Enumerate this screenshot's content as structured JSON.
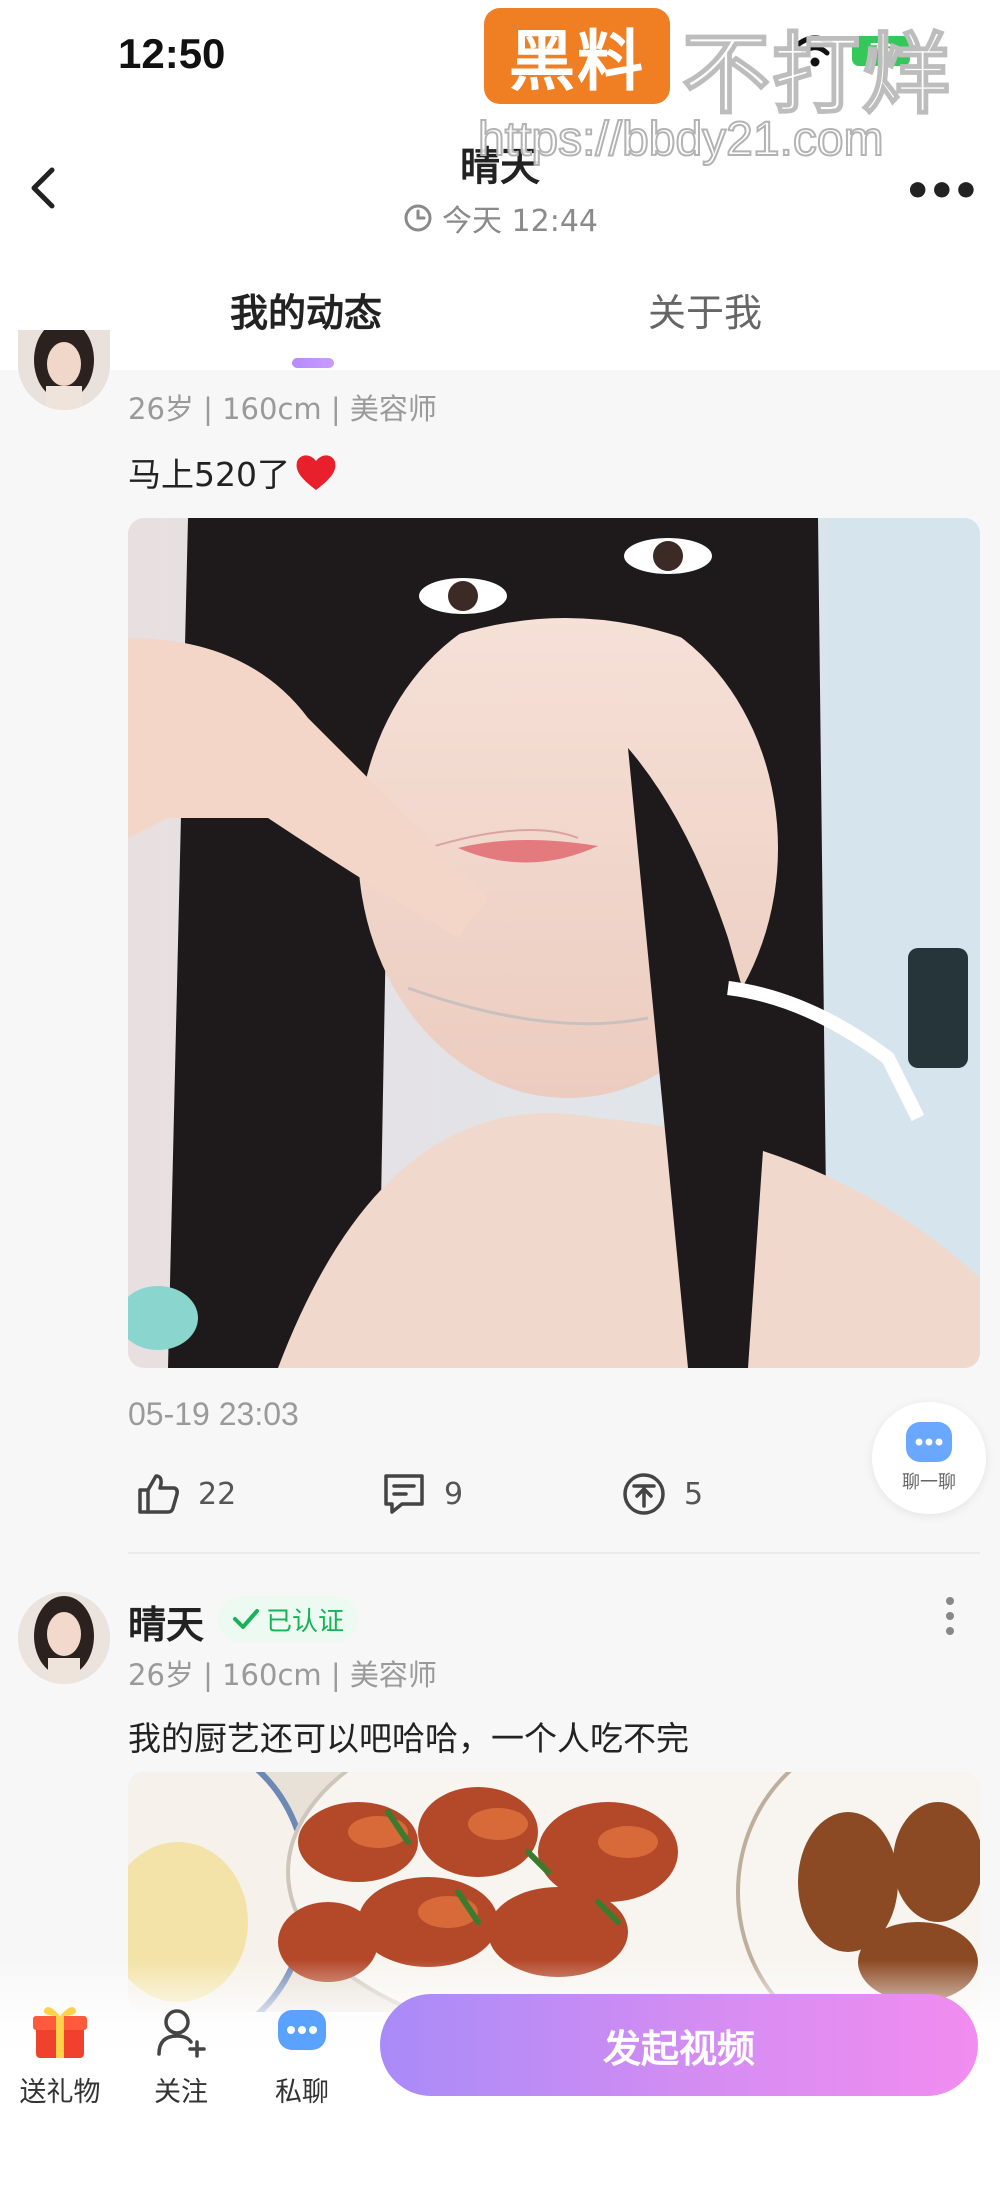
{
  "status_bar": {
    "time": "12:50",
    "battery": "76"
  },
  "watermark": {
    "badge": "黑料",
    "text": "不打烊",
    "url": "https://bbdy21.com"
  },
  "header": {
    "title": "晴天",
    "subtitle": "今天 12:44",
    "tabs": [
      {
        "label": "我的动态",
        "active": true
      },
      {
        "label": "关于我",
        "active": false
      }
    ]
  },
  "posts": [
    {
      "meta": "26岁 | 160cm | 美容师",
      "text": "马上520了",
      "date": "05-19 23:03",
      "likes": "22",
      "comments": "9",
      "shares": "5"
    },
    {
      "name": "晴天",
      "verified": "已认证",
      "meta": "26岁 | 160cm | 美容师",
      "text": "我的厨艺还可以吧哈哈，一个人吃不完"
    }
  ],
  "float_chat": {
    "label": "聊一聊"
  },
  "bottom_bar": {
    "gift": "送礼物",
    "follow": "关注",
    "message": "私聊",
    "cta": "发起视频"
  },
  "colors": {
    "accent_purple": "#b48bff",
    "verified_green": "#19b25a",
    "battery_green": "#34c759"
  }
}
